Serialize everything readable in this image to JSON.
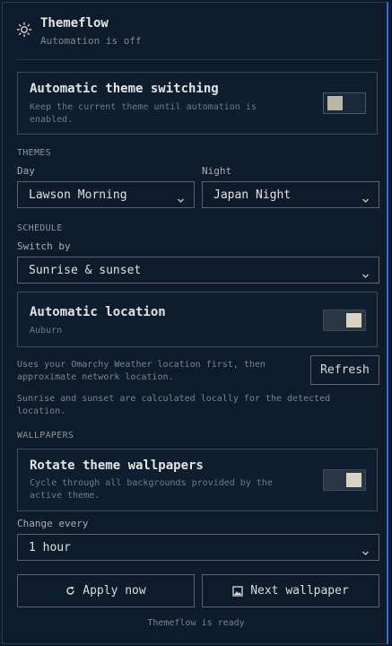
{
  "header": {
    "title": "Themeflow",
    "subtitle": "Automation is off",
    "icon": "sun-icon"
  },
  "automatic_switching": {
    "title": "Automatic theme switching",
    "description": "Keep the current theme until automation is enabled.",
    "enabled": false
  },
  "themes": {
    "section": "THEMES",
    "day_label": "Day",
    "day_value": "Lawson Morning",
    "night_label": "Night",
    "night_value": "Japan Night"
  },
  "schedule": {
    "section": "SCHEDULE",
    "switch_by_label": "Switch by",
    "switch_by_value": "Sunrise & sunset",
    "auto_location": {
      "title": "Automatic location",
      "location": "Auburn",
      "enabled": true
    },
    "location_note": "Uses your Omarchy Weather location first, then approximate network location.",
    "refresh_label": "Refresh",
    "calc_note": "Sunrise and sunset are calculated locally for the detected location."
  },
  "wallpapers": {
    "section": "WALLPAPERS",
    "rotate": {
      "title": "Rotate theme wallpapers",
      "description": "Cycle through all backgrounds provided by the active theme.",
      "enabled": true
    },
    "change_every_label": "Change every",
    "change_every_value": "1 hour"
  },
  "actions": {
    "apply_label": "Apply now",
    "next_label": "Next wallpaper"
  },
  "status": "Themeflow is ready"
}
